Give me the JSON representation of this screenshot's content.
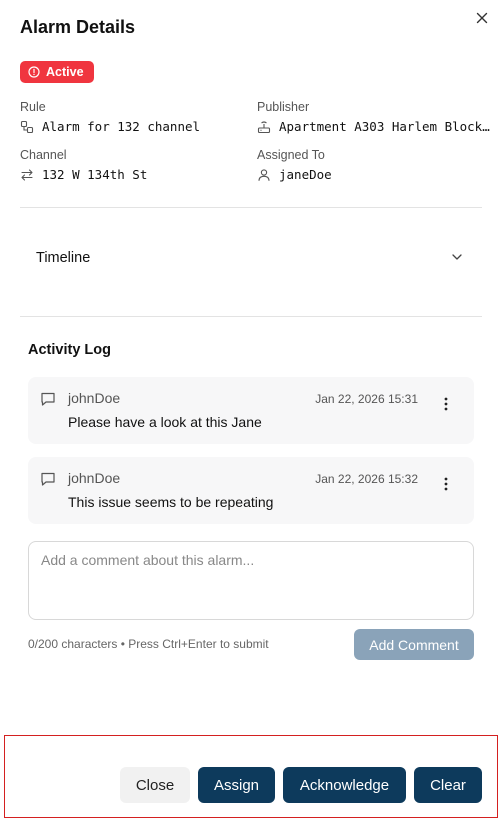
{
  "dialog": {
    "title": "Alarm Details",
    "status_badge": "Active",
    "status_color": "#f0353f",
    "close_icon": "close-icon"
  },
  "details": {
    "rule_label": "Rule",
    "rule_value": "Alarm for 132 channel",
    "publisher_label": "Publisher",
    "publisher_value": "Apartment A303 Harlem Block…",
    "channel_label": "Channel",
    "channel_value": "132 W 134th St",
    "assigned_label": "Assigned To",
    "assigned_value": "janeDoe"
  },
  "timeline": {
    "label": "Timeline",
    "expanded": false
  },
  "activity_log": {
    "title": "Activity Log",
    "entries": [
      {
        "user": "johnDoe",
        "time": "Jan 22, 2026 15:31",
        "message": "Please have a look at this Jane"
      },
      {
        "user": "johnDoe",
        "time": "Jan 22, 2026 15:32",
        "message": "This issue seems to be repeating"
      }
    ]
  },
  "comment": {
    "placeholder": "Add a comment about this alarm...",
    "value": "",
    "hint": "0/200 characters • Press Ctrl+Enter to submit",
    "submit_label": "Add Comment"
  },
  "footer": {
    "close_label": "Close",
    "assign_label": "Assign",
    "acknowledge_label": "Acknowledge",
    "clear_label": "Clear",
    "primary_color": "#0d3a5c"
  }
}
